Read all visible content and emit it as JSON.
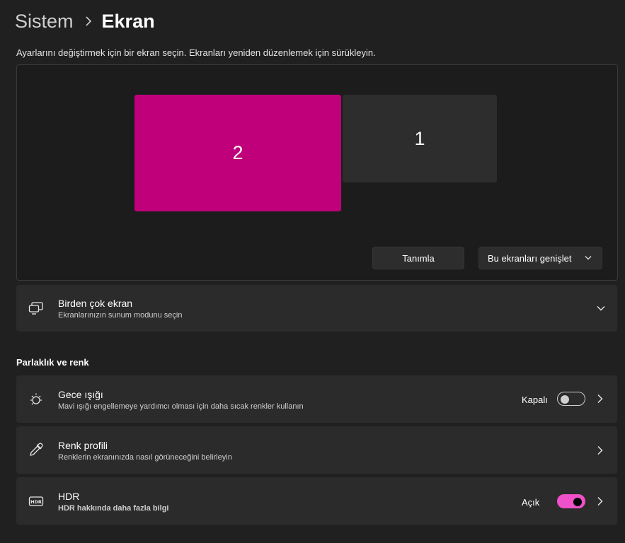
{
  "breadcrumb": {
    "parent": "Sistem",
    "current": "Ekran"
  },
  "hint": "Ayarlarını değiştirmek için bir ekran seçin. Ekranları yeniden düzenlemek için sürükleyin.",
  "arrangement": {
    "monitors": [
      {
        "label": "2",
        "selected": true,
        "color": "#c0007a"
      },
      {
        "label": "1",
        "selected": false,
        "color": "#2d2d2d"
      }
    ],
    "identify_label": "Tanımla",
    "mode_select": {
      "value": "Bu ekranları genişlet"
    }
  },
  "multiple_displays": {
    "title": "Birden çok ekran",
    "subtitle": "Ekranlarınızın sunum modunu seçin"
  },
  "brightness_section": {
    "title": "Parlaklık ve renk"
  },
  "night_light": {
    "title": "Gece ışığı",
    "subtitle": "Mavi ışığı engellemeye yardımcı olması için daha sıcak renkler kullanın",
    "state_label": "Kapalı",
    "enabled": false
  },
  "color_profile": {
    "title": "Renk profili",
    "subtitle": "Renklerin ekranınızda nasıl görüneceğini belirleyin"
  },
  "hdr": {
    "title": "HDR",
    "link": "HDR hakkında daha fazla bilgi",
    "state_label": "Açık",
    "enabled": true
  },
  "colors": {
    "accent": "#f050c8",
    "link": "#f078d8",
    "background": "#202020",
    "card": "#2b2b2b"
  }
}
